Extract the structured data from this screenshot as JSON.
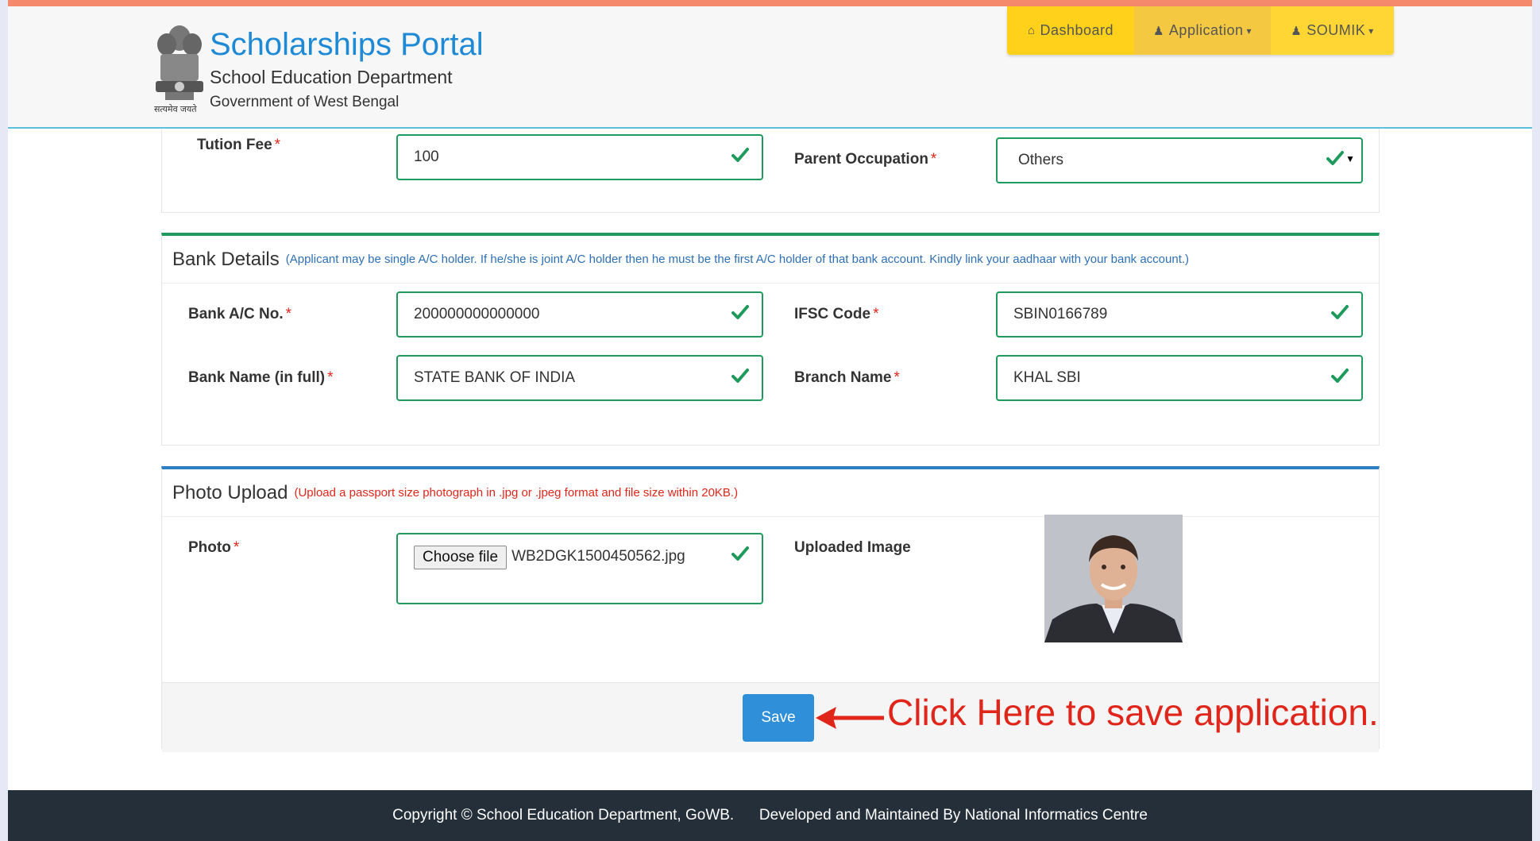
{
  "header": {
    "title": "Scholarships Portal",
    "department": "School Education Department",
    "government": "Government of West Bengal",
    "emblem_motto": "सत्यमेव जयते"
  },
  "nav": {
    "dashboard": "Dashboard",
    "application": "Application",
    "user": "SOUMIK"
  },
  "fee_section": {
    "tution_fee_label": "Tution Fee",
    "tution_fee_value": "100",
    "parent_occupation_label": "Parent Occupation",
    "parent_occupation_value": "Others"
  },
  "bank": {
    "title": "Bank Details",
    "note": "(Applicant may be single A/C holder. If he/she is joint A/C holder then he must be the first A/C holder of that bank account. Kindly link your aadhaar with your bank account.)",
    "ac_label": "Bank A/C No.",
    "ac_value": "200000000000000",
    "ifsc_label": "IFSC Code",
    "ifsc_value": "SBIN0166789",
    "bank_name_label": "Bank Name (in full)",
    "bank_name_value": "STATE BANK OF INDIA",
    "branch_label": "Branch Name",
    "branch_value": "KHAL SBI"
  },
  "photo": {
    "title": "Photo Upload",
    "note": "(Upload a passport size photograph in .jpg or .jpeg format and file size within 20KB.)",
    "photo_label": "Photo",
    "choose_label": "Choose file",
    "file_name": "WB2DGK1500450562.jpg",
    "uploaded_label": "Uploaded Image"
  },
  "actions": {
    "save_label": "Save",
    "annotation": "Click Here to save application."
  },
  "footer": {
    "copyright": "Copyright © School Education Department, GoWB.",
    "developed": "Developed and Maintained By National Informatics Centre"
  },
  "colors": {
    "accent_green": "#1e9a5c",
    "accent_blue": "#2b7ec1",
    "brand_blue": "#1e8ad6",
    "nav_yellow": "#ffd11a",
    "annotation_red": "#e0261b",
    "footer_bg": "#252f3a"
  }
}
